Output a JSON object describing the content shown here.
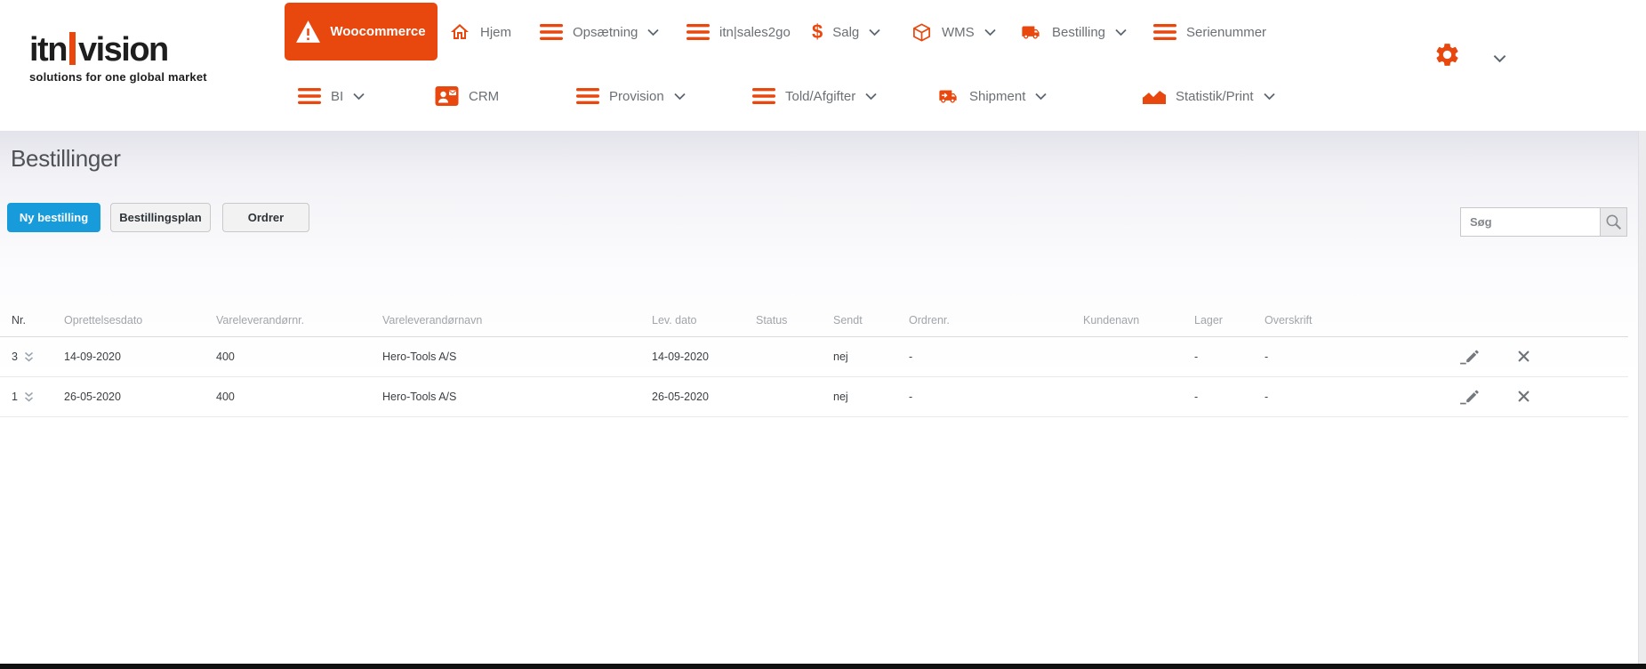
{
  "brand": {
    "logo_part1": "itn",
    "logo_part2": "vision",
    "tagline": "solutions for one global market"
  },
  "nav": {
    "woocommerce": "Woocommerce",
    "hjem": "Hjem",
    "opsaetning": "Opsætning",
    "sales2go": "itn|sales2go",
    "salg": "Salg",
    "wms": "WMS",
    "bestilling": "Bestilling",
    "serienummer": "Serienummer",
    "bi": "BI",
    "crm": "CRM",
    "provision": "Provision",
    "told_afgifter": "Told/Afgifter",
    "shipment": "Shipment",
    "statistik_print": "Statistik/Print"
  },
  "page": {
    "title": "Bestillinger"
  },
  "toolbar": {
    "new_order": "Ny bestilling",
    "order_plan": "Bestillingsplan",
    "orders": "Ordrer",
    "search_placeholder": "Søg"
  },
  "table": {
    "headers": {
      "nr": "Nr.",
      "oprettelsesdato": "Oprettelsesdato",
      "vareleverandornr": "Vareleverandørnr.",
      "vareleverandornavn": "Vareleverandørnavn",
      "lev_dato": "Lev. dato",
      "status": "Status",
      "sendt": "Sendt",
      "ordrenr": "Ordrenr.",
      "kundenavn": "Kundenavn",
      "lager": "Lager",
      "overskrift": "Overskrift"
    },
    "rows": [
      {
        "nr": "3",
        "oprettelsesdato": "14-09-2020",
        "vareleverandornr": "400",
        "vareleverandornavn": "Hero-Tools A/S",
        "lev_dato": "14-09-2020",
        "status": "",
        "sendt": "nej",
        "ordrenr": "-",
        "kundenavn": "",
        "lager": "-",
        "overskrift": "-"
      },
      {
        "nr": "1",
        "oprettelsesdato": "26-05-2020",
        "vareleverandornr": "400",
        "vareleverandornavn": "Hero-Tools A/S",
        "lev_dato": "26-05-2020",
        "status": "",
        "sendt": "nej",
        "ordrenr": "-",
        "kundenavn": "",
        "lager": "-",
        "overskrift": "-"
      }
    ]
  },
  "colors": {
    "accent_orange": "#e8470e",
    "primary_button_blue": "#189bdb"
  }
}
